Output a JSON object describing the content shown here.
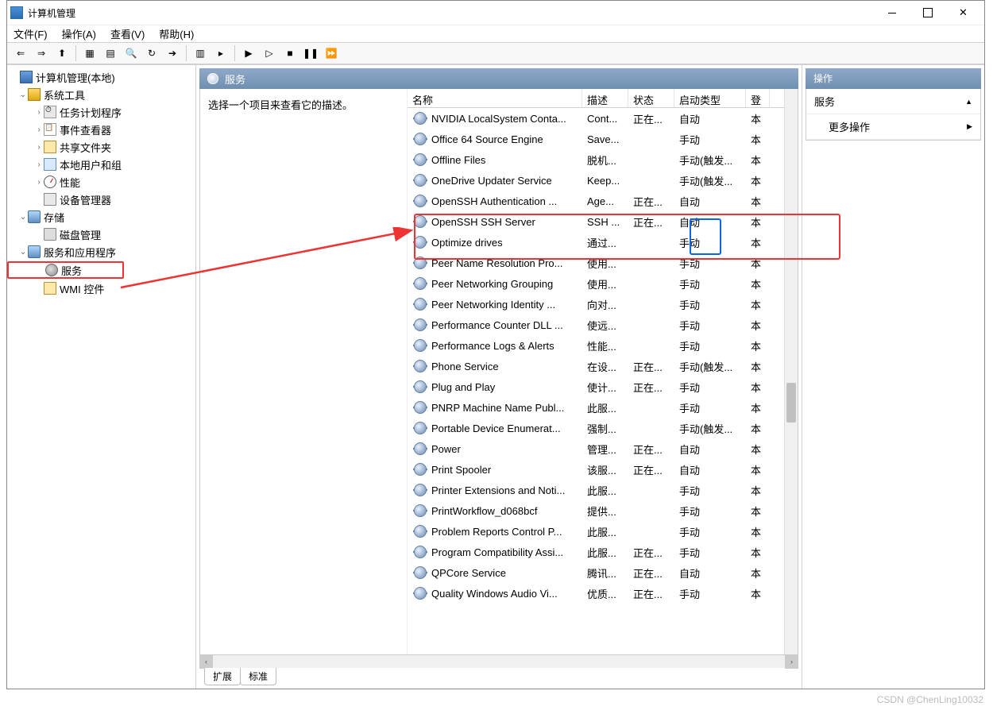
{
  "window": {
    "title": "计算机管理"
  },
  "menu": {
    "file": "文件(F)",
    "action": "操作(A)",
    "view": "查看(V)",
    "help": "帮助(H)"
  },
  "toolbar_icons": [
    "⇐",
    "⇒",
    "⬆",
    "|",
    "▦",
    "▤",
    "🔍",
    "↻",
    "➔",
    "|",
    "▥",
    "▸",
    "|",
    "▶",
    "▷",
    "■",
    "❚❚",
    "⏩"
  ],
  "tree": {
    "root": "计算机管理(本地)",
    "sys_tools": "系统工具",
    "task": "任务计划程序",
    "event": "事件查看器",
    "share": "共享文件夹",
    "users": "本地用户和组",
    "perf": "性能",
    "device": "设备管理器",
    "storage": "存储",
    "disk": "磁盘管理",
    "svcapp": "服务和应用程序",
    "services": "服务",
    "wmi": "WMI 控件"
  },
  "center": {
    "header": "服务",
    "desc_prompt": "选择一个项目来查看它的描述。",
    "columns": {
      "name": "名称",
      "desc": "描述",
      "status": "状态",
      "startup": "启动类型",
      "logon": "登"
    },
    "services": [
      {
        "name": "NVIDIA LocalSystem Conta...",
        "desc": "Cont...",
        "status": "正在...",
        "start": "自动",
        "log": "本"
      },
      {
        "name": "Office 64 Source Engine",
        "desc": "Save...",
        "status": "",
        "start": "手动",
        "log": "本"
      },
      {
        "name": "Offline Files",
        "desc": "脱机...",
        "status": "",
        "start": "手动(触发...",
        "log": "本"
      },
      {
        "name": "OneDrive Updater Service",
        "desc": "Keep...",
        "status": "",
        "start": "手动(触发...",
        "log": "本"
      },
      {
        "name": "OpenSSH Authentication ...",
        "desc": "Age...",
        "status": "正在...",
        "start": "自动",
        "log": "本"
      },
      {
        "name": "OpenSSH SSH Server",
        "desc": "SSH ...",
        "status": "正在...",
        "start": "自动",
        "log": "本"
      },
      {
        "name": "Optimize drives",
        "desc": "通过...",
        "status": "",
        "start": "手动",
        "log": "本"
      },
      {
        "name": "Peer Name Resolution Pro...",
        "desc": "使用...",
        "status": "",
        "start": "手动",
        "log": "本"
      },
      {
        "name": "Peer Networking Grouping",
        "desc": "使用...",
        "status": "",
        "start": "手动",
        "log": "本"
      },
      {
        "name": "Peer Networking Identity ...",
        "desc": "向对...",
        "status": "",
        "start": "手动",
        "log": "本"
      },
      {
        "name": "Performance Counter DLL ...",
        "desc": "使远...",
        "status": "",
        "start": "手动",
        "log": "本"
      },
      {
        "name": "Performance Logs & Alerts",
        "desc": "性能...",
        "status": "",
        "start": "手动",
        "log": "本"
      },
      {
        "name": "Phone Service",
        "desc": "在设...",
        "status": "正在...",
        "start": "手动(触发...",
        "log": "本"
      },
      {
        "name": "Plug and Play",
        "desc": "使计...",
        "status": "正在...",
        "start": "手动",
        "log": "本"
      },
      {
        "name": "PNRP Machine Name Publ...",
        "desc": "此服...",
        "status": "",
        "start": "手动",
        "log": "本"
      },
      {
        "name": "Portable Device Enumerat...",
        "desc": "强制...",
        "status": "",
        "start": "手动(触发...",
        "log": "本"
      },
      {
        "name": "Power",
        "desc": "管理...",
        "status": "正在...",
        "start": "自动",
        "log": "本"
      },
      {
        "name": "Print Spooler",
        "desc": "该服...",
        "status": "正在...",
        "start": "自动",
        "log": "本"
      },
      {
        "name": "Printer Extensions and Noti...",
        "desc": "此服...",
        "status": "",
        "start": "手动",
        "log": "本"
      },
      {
        "name": "PrintWorkflow_d068bcf",
        "desc": "提供...",
        "status": "",
        "start": "手动",
        "log": "本"
      },
      {
        "name": "Problem Reports Control P...",
        "desc": "此服...",
        "status": "",
        "start": "手动",
        "log": "本"
      },
      {
        "name": "Program Compatibility Assi...",
        "desc": "此服...",
        "status": "正在...",
        "start": "手动",
        "log": "本"
      },
      {
        "name": "QPCore Service",
        "desc": "腾讯...",
        "status": "正在...",
        "start": "自动",
        "log": "本"
      },
      {
        "name": "Quality Windows Audio Vi...",
        "desc": "优质...",
        "status": "正在...",
        "start": "手动",
        "log": "本"
      }
    ],
    "tabs": {
      "ext": "扩展",
      "std": "标准"
    }
  },
  "actions": {
    "header": "操作",
    "services": "服务",
    "more": "更多操作"
  },
  "watermark": "CSDN @ChenLing10032"
}
